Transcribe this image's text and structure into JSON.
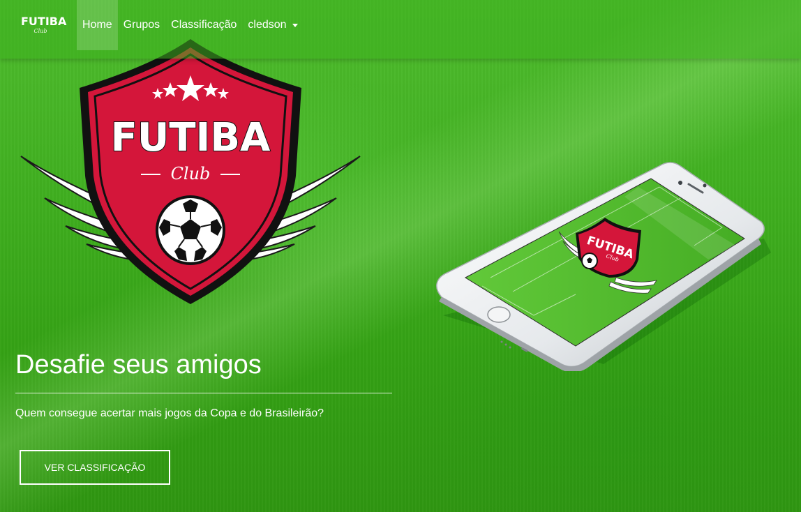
{
  "navbar": {
    "brand": {
      "main": "FUTIBA",
      "sub": "Club"
    },
    "links": [
      {
        "label": "Home",
        "active": true
      },
      {
        "label": "Grupos"
      },
      {
        "label": "Classificação"
      },
      {
        "label": "cledson",
        "dropdown": true
      }
    ]
  },
  "logo": {
    "title": "FUTIBA",
    "subtitle": "Club"
  },
  "phone_logo": {
    "title": "FUTIBA",
    "subtitle": "Club"
  },
  "hero": {
    "title": "Desafie seus amigos",
    "subtitle": "Quem consegue acertar mais jogos da Copa e do Brasileirão?",
    "button_label": "VER CLASSIFICAÇÃO"
  },
  "colors": {
    "grass": "#3fae1f",
    "shield_red": "#d4163a",
    "shield_black": "#111111",
    "white": "#ffffff"
  }
}
